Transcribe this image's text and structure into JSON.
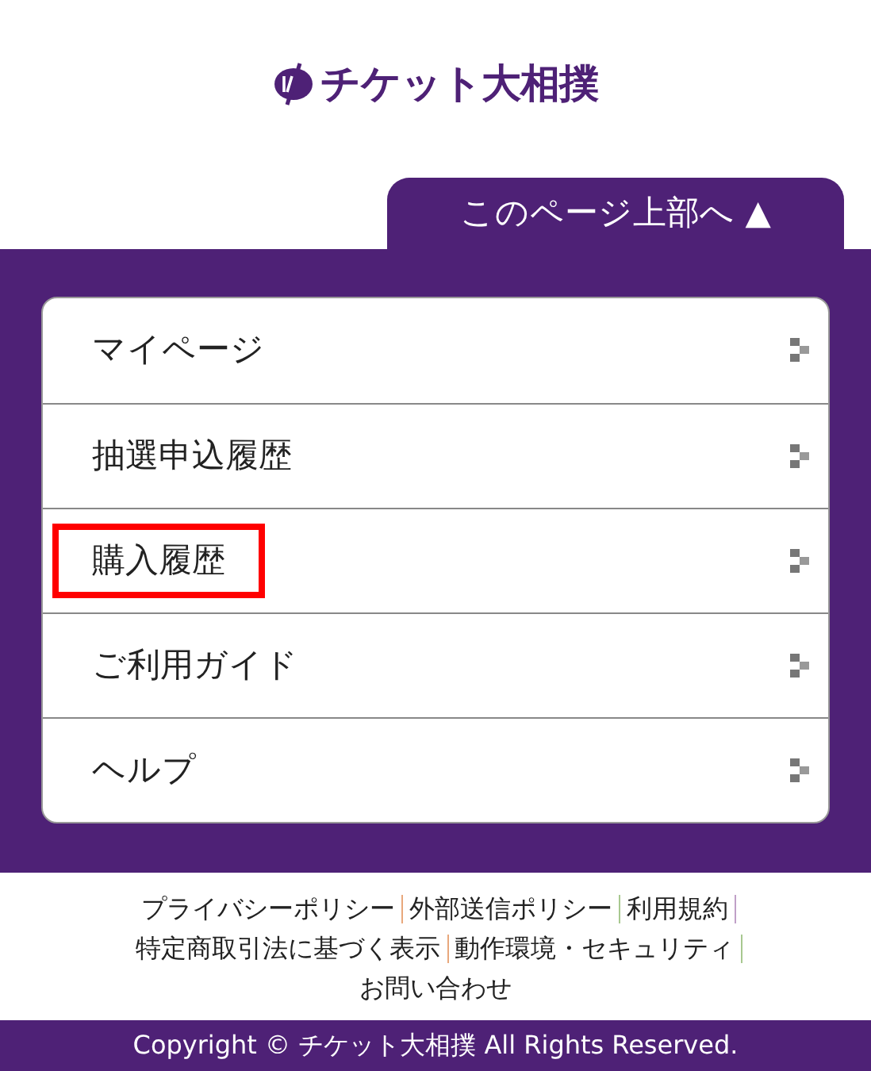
{
  "logo": {
    "text": "チケット大相撲"
  },
  "back_to_top": {
    "label": "このページ上部へ ▲"
  },
  "menu": [
    {
      "label": "マイページ",
      "highlighted": false
    },
    {
      "label": "抽選申込履歴",
      "highlighted": false
    },
    {
      "label": "購入履歴",
      "highlighted": true
    },
    {
      "label": "ご利用ガイド",
      "highlighted": false
    },
    {
      "label": "ヘルプ",
      "highlighted": false
    }
  ],
  "footer_links": [
    [
      "プライバシーポリシー",
      "外部送信ポリシー",
      "利用規約"
    ],
    [
      "特定商取引法に基づく表示",
      "動作環境・セキュリティ"
    ],
    [
      "お問い合わせ"
    ]
  ],
  "copyright": "Copyright © チケット大相撲 All Rights Reserved."
}
